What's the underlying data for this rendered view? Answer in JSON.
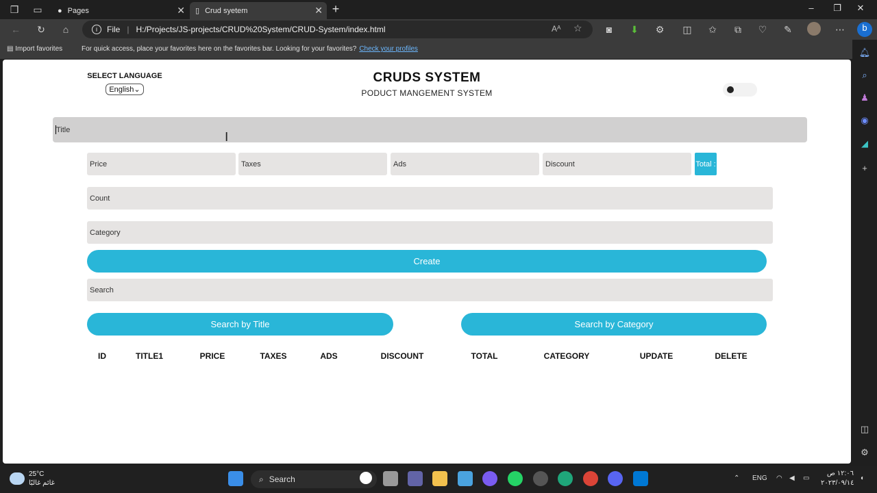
{
  "browser": {
    "tabs": [
      {
        "title": "Pages"
      },
      {
        "title": "Crud syetem"
      }
    ],
    "address": {
      "scheme": "File",
      "url": "H:/Projects/JS-projects/CRUD%20System/CRUD-System/index.html"
    },
    "favbar": {
      "import_label": "Import favorites",
      "message": "For quick access, place your favorites here on the favorites bar. Looking for your favorites?",
      "link": "Check your profiles"
    }
  },
  "page": {
    "language": {
      "label": "SELECT LANGUAGE",
      "selected": "English"
    },
    "title": "CRUDS SYSTEM",
    "subtitle": "PODUCT MANGEMENT SYSTEM",
    "inputs": {
      "title_placeholder": "Title",
      "price_placeholder": "Price",
      "taxes_placeholder": "Taxes",
      "ads_placeholder": "Ads",
      "discount_placeholder": "Discount",
      "count_placeholder": "Count",
      "category_placeholder": "Category",
      "search_placeholder": "Search"
    },
    "total_label": "Total :",
    "create_label": "Create",
    "search_by_title_label": "Search by Title",
    "search_by_category_label": "Search by Category",
    "table_headers": [
      "ID",
      "TITLE1",
      "PRICE",
      "TAXES",
      "ADS",
      "DISCOUNT",
      "TOTAL",
      "CATEGORY",
      "UPDATE",
      "DELETE"
    ]
  },
  "taskbar": {
    "weather_temp": "25°C",
    "weather_desc": "غائم غالبًا",
    "search_label": "Search",
    "language": "ENG",
    "time": "١٢:٠٦ ص",
    "date": "٢٠٢٣/٠٩/١٤"
  },
  "colors": {
    "accent": "#29b6d8",
    "input_bg": "#e6e4e3",
    "title_input_bg": "#d1d0d0"
  }
}
